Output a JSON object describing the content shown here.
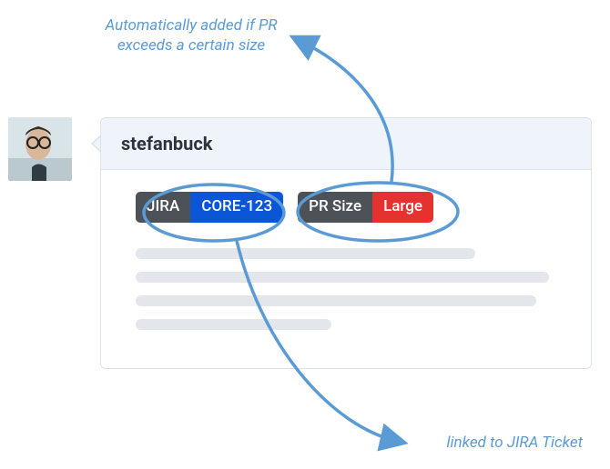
{
  "annotations": {
    "top": "Automatically added if PR exceeds a certain size",
    "bottom": "linked to JIRA Ticket"
  },
  "comment": {
    "author": "stefanbuck"
  },
  "badges": {
    "jira": {
      "left": "JIRA",
      "right": "CORE-123"
    },
    "prsize": {
      "left": "PR Size",
      "right": "Large"
    }
  },
  "colors": {
    "annotation": "#5b9bd5",
    "badge_left_bg": "#4d5258",
    "jira_right_bg": "#0a56d6",
    "prsize_right_bg": "#e63131",
    "header_bg": "#eef4fa",
    "border": "#dce1e6",
    "placeholder": "#e3e6ea"
  }
}
